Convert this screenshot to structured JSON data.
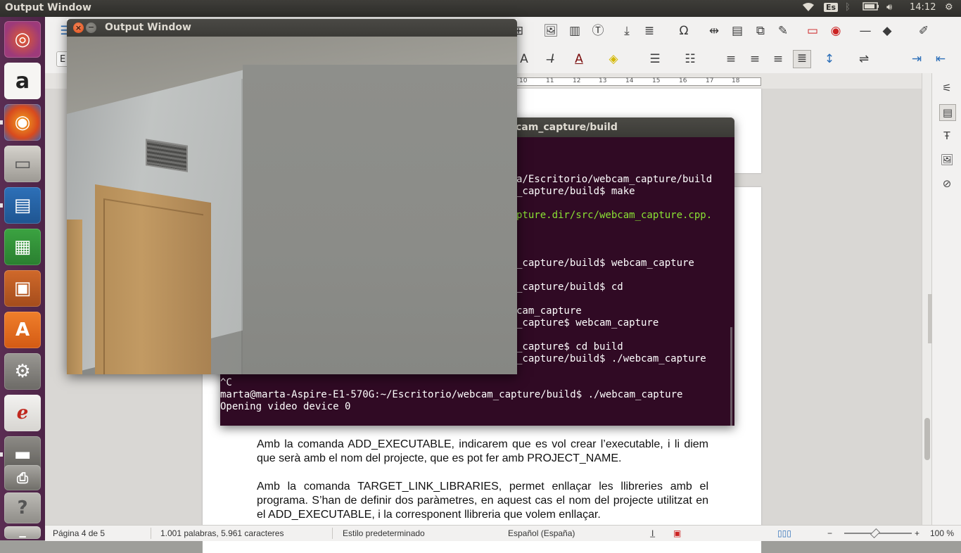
{
  "top_panel": {
    "title": "Output Window",
    "keyboard_layout": "Es",
    "clock": "14:12"
  },
  "launcher": {
    "items": [
      "Ubuntu Dash",
      "Amazon",
      "Firefox",
      "Files",
      "LibreOffice Writer",
      "LibreOffice Calc",
      "LibreOffice Impress",
      "Ubuntu Software",
      "System Settings",
      "Document Viewer",
      "Scanner",
      "Printer",
      "Help",
      "Trash"
    ]
  },
  "writer": {
    "style_box": "E",
    "ruler_numbers": [
      "10",
      "11",
      "12",
      "13",
      "14",
      "15",
      "16",
      "17",
      "18"
    ],
    "paragraphs": [
      "Amb la comanda ADD_EXECUTABLE, indicarem que es vol crear l’executable, i li diem que serà amb el nom del projecte, que es pot fer amb PROJECT_NAME.",
      "Amb la comanda TARGET_LINK_LIBRARIES, permet enllaçar les llibreries amb el programa. S’han de definir dos paràmetres, en aquest cas el nom del projecte utilitzat en el ADD_EXECUTABLE, i la corresponent llibreria que volem enllaçar."
    ],
    "status": {
      "page": "Página 4 de 5",
      "words": "1.001 palabras, 5.961 caracteres",
      "style": "Estilo predeterminado",
      "language": "Español (España)",
      "zoom": "100 %"
    }
  },
  "terminal": {
    "title": "cam_capture/build",
    "lines": [
      {
        "text": "a/Escritorio/webcam_capture/build",
        "color": "white"
      },
      {
        "text": "_capture/build$ make",
        "color": "white"
      },
      {
        "text": "pture.dir/src/webcam_capture.cpp.",
        "color": "green"
      },
      {
        "text": "_capture/build$ webcam_capture",
        "color": "white"
      },
      {
        "text": "_capture/build$ cd",
        "color": "white"
      },
      {
        "text": "cam_capture",
        "color": "white"
      },
      {
        "text": "_capture$ webcam_capture",
        "color": "white"
      },
      {
        "text": "_capture$ cd build",
        "color": "white"
      },
      {
        "text": "_capture/build$ ./webcam_capture",
        "color": "white"
      },
      {
        "text": "^C",
        "color": "white"
      },
      {
        "text": "marta@marta-Aspire-E1-570G:~/Escritorio/webcam_capture/build$ ./webcam_capture",
        "color": "white"
      },
      {
        "text": "Opening video device 0",
        "color": "white"
      }
    ]
  },
  "output_window": {
    "title": "Output Window",
    "close_glyph": "×",
    "minimize_glyph": "−"
  }
}
